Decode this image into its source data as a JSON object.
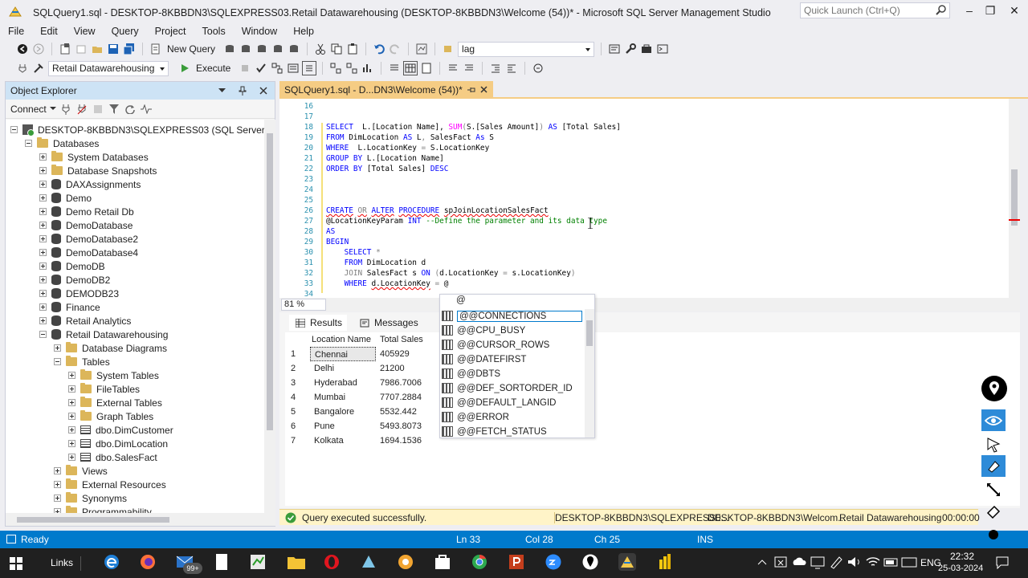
{
  "window": {
    "title": "SQLQuery1.sql - DESKTOP-8KBBDN3\\SQLEXPRESS03.Retail Datawarehousing (DESKTOP-8KBBDN3\\Welcome (54))* - Microsoft SQL Server Management Studio",
    "quick_launch_placeholder": "Quick Launch (Ctrl+Q)"
  },
  "menu": [
    "File",
    "Edit",
    "View",
    "Query",
    "Project",
    "Tools",
    "Window",
    "Help"
  ],
  "toolbar": {
    "new_query_label": "New Query",
    "search_value": "lag",
    "database_selected": "Retail Datawarehousing",
    "execute_label": "Execute"
  },
  "object_explorer": {
    "title": "Object Explorer",
    "connect_label": "Connect",
    "server": "DESKTOP-8KBBDN3\\SQLEXPRESS03 (SQL Server 16.0.100",
    "databases_label": "Databases",
    "db_items": [
      "System Databases",
      "Database Snapshots",
      "DAXAssignments",
      "Demo",
      "Demo Retail Db",
      "DemoDatabase",
      "DemoDatabase2",
      "DemoDatabase4",
      "DemoDB",
      "DemoDB2",
      "DEMODB23",
      "Finance",
      "Retail Analytics",
      "Retail Datawarehousing"
    ],
    "rdw_children": [
      "Database Diagrams",
      "Tables"
    ],
    "tables_children": [
      "System Tables",
      "FileTables",
      "External Tables",
      "Graph Tables",
      "dbo.DimCustomer",
      "dbo.DimLocation",
      "dbo.SalesFact"
    ],
    "rdw_more": [
      "Views",
      "External Resources",
      "Synonyms",
      "Programmability"
    ]
  },
  "editor": {
    "tab_label": "SQLQuery1.sql - D...DN3\\Welcome (54))*",
    "zoom": "81 %",
    "lines": [
      {
        "n": "16",
        "segs": []
      },
      {
        "n": "17",
        "segs": []
      },
      {
        "n": "18",
        "segs": [
          [
            "kw",
            "SELECT"
          ],
          [
            "dk",
            "  L.[Location Name], "
          ],
          [
            "fn",
            "SUM"
          ],
          [
            "gy",
            "("
          ],
          [
            "dk",
            "S.[Sales Amount]"
          ],
          [
            "gy",
            ")"
          ],
          [
            "dk",
            " "
          ],
          [
            "kw",
            "AS"
          ],
          [
            "dk",
            " [Total Sales]"
          ]
        ]
      },
      {
        "n": "19",
        "segs": [
          [
            "kw",
            "FROM"
          ],
          [
            "dk",
            " DimLocation "
          ],
          [
            "kw",
            "AS"
          ],
          [
            "dk",
            " L"
          ],
          [
            "gy",
            ","
          ],
          [
            "dk",
            " SalesFact "
          ],
          [
            "kw",
            "As"
          ],
          [
            "dk",
            " S"
          ]
        ]
      },
      {
        "n": "20",
        "segs": [
          [
            "kw",
            "WHERE"
          ],
          [
            "dk",
            "  L.LocationKey "
          ],
          [
            "gy",
            "="
          ],
          [
            "dk",
            " S.LocationKey"
          ]
        ]
      },
      {
        "n": "21",
        "segs": [
          [
            "kw",
            "GROUP BY"
          ],
          [
            "dk",
            " L.[Location Name]"
          ]
        ]
      },
      {
        "n": "22",
        "segs": [
          [
            "kw",
            "ORDER BY"
          ],
          [
            "dk",
            " [Total Sales] "
          ],
          [
            "kw",
            "DESC"
          ]
        ]
      },
      {
        "n": "23",
        "segs": []
      },
      {
        "n": "24",
        "segs": []
      },
      {
        "n": "25",
        "segs": []
      },
      {
        "n": "26",
        "segs": [
          [
            "kwu",
            "CREATE"
          ],
          [
            "dk",
            " "
          ],
          [
            "gyu",
            "OR"
          ],
          [
            "dk",
            " "
          ],
          [
            "kwu",
            "ALTER"
          ],
          [
            "dk",
            " "
          ],
          [
            "kwu",
            "PROCEDURE"
          ],
          [
            "dk",
            " "
          ],
          [
            "dku",
            "spJoinLocationSalesFact"
          ]
        ]
      },
      {
        "n": "27",
        "segs": [
          [
            "dk",
            "@LocationKeyParam "
          ],
          [
            "kw",
            "INT"
          ],
          [
            "dk",
            " "
          ],
          [
            "cm",
            "--Define the parameter and its data type"
          ]
        ]
      },
      {
        "n": "28",
        "segs": [
          [
            "kw",
            "AS"
          ]
        ]
      },
      {
        "n": "29",
        "segs": [
          [
            "kw",
            "BEGIN"
          ]
        ]
      },
      {
        "n": "30",
        "segs": [
          [
            "dk",
            "    "
          ],
          [
            "kw",
            "SELECT"
          ],
          [
            "dk",
            " "
          ],
          [
            "gy",
            "*"
          ]
        ]
      },
      {
        "n": "31",
        "segs": [
          [
            "dk",
            "    "
          ],
          [
            "kw",
            "FROM"
          ],
          [
            "dk",
            " DimLocation d"
          ]
        ]
      },
      {
        "n": "32",
        "segs": [
          [
            "dk",
            "    "
          ],
          [
            "gy",
            "JOIN"
          ],
          [
            "dk",
            " SalesFact s "
          ],
          [
            "kw",
            "ON"
          ],
          [
            "dk",
            " "
          ],
          [
            "gy",
            "("
          ],
          [
            "dk",
            "d.LocationKey "
          ],
          [
            "gy",
            "="
          ],
          [
            "dk",
            " s.LocationKey"
          ],
          [
            "gy",
            ")"
          ]
        ]
      },
      {
        "n": "33",
        "segs": [
          [
            "dk",
            "    "
          ],
          [
            "kw",
            "WHERE"
          ],
          [
            "dk",
            " "
          ],
          [
            "dku",
            "d.LocationKey"
          ],
          [
            "dk",
            " "
          ],
          [
            "gy",
            "="
          ],
          [
            "dk",
            " @"
          ]
        ]
      },
      {
        "n": "34",
        "segs": []
      }
    ]
  },
  "results": {
    "tab_results": "Results",
    "tab_messages": "Messages",
    "columns": [
      "Location Name",
      "Total Sales"
    ],
    "rows": [
      [
        "1",
        "Chennai",
        "405929"
      ],
      [
        "2",
        "Delhi",
        "21200"
      ],
      [
        "3",
        "Hyderabad",
        "7986.7006"
      ],
      [
        "4",
        "Mumbai",
        "7707.2884"
      ],
      [
        "5",
        "Bangalore",
        "5532.442"
      ],
      [
        "6",
        "Pune",
        "5493.8073"
      ],
      [
        "7",
        "Kolkata",
        "1694.1536"
      ]
    ]
  },
  "intellisense": {
    "typed": "@",
    "items": [
      "@@CONNECTIONS",
      "@@CPU_BUSY",
      "@@CURSOR_ROWS",
      "@@DATEFIRST",
      "@@DBTS",
      "@@DEF_SORTORDER_ID",
      "@@DEFAULT_LANGID",
      "@@ERROR",
      "@@FETCH_STATUS"
    ]
  },
  "query_status": {
    "message": "Query executed successfully.",
    "server": "DESKTOP-8KBBDN3\\SQLEXPRESS0...",
    "user": "DESKTOP-8KBBDN3\\Welcom...",
    "database": "Retail Datawarehousing",
    "time": "00:00:00"
  },
  "statusbar": {
    "ready": "Ready",
    "ln": "Ln 33",
    "col": "Col 28",
    "ch": "Ch 25",
    "mode": "INS"
  },
  "taskbar": {
    "links": "Links",
    "badge": "99+",
    "lang": "ENG",
    "time": "22:32",
    "date": "25-03-2024"
  },
  "colors": {
    "accent_blue": "#007acc",
    "tab_yellow": "#f5cc84",
    "explorer_header": "#cde3f5",
    "keyword": "#0000ff",
    "comment": "#008000",
    "function": "#ff00ff"
  }
}
